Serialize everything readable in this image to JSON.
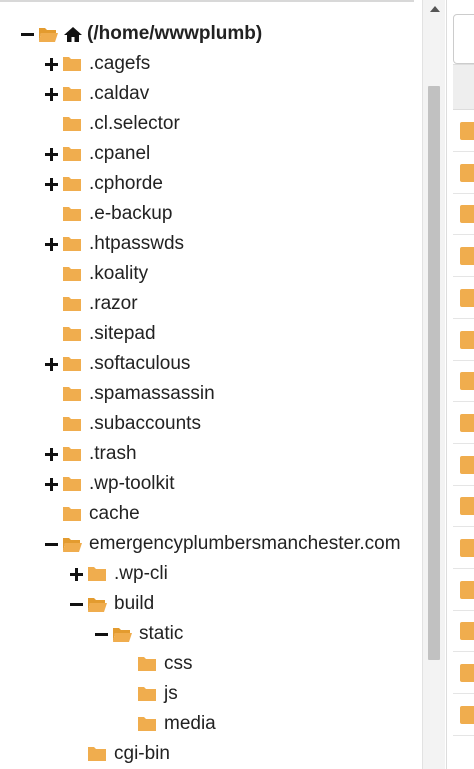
{
  "colors": {
    "folder": "#f0ad4e",
    "folder_dark": "#e39b2f",
    "text": "#222222",
    "scrollbar_thumb": "#c1c1c1"
  },
  "icons": {
    "root_toggle": "minus-icon",
    "root_folder": "folder-open-icon",
    "root_home": "home-icon"
  },
  "tree": {
    "root": {
      "label": "(/home/wwwplumb)",
      "expanded": true
    },
    "items": [
      {
        "label": ".cagefs",
        "toggle": "plus",
        "open": false,
        "level": 1
      },
      {
        "label": ".caldav",
        "toggle": "plus",
        "open": false,
        "level": 1
      },
      {
        "label": ".cl.selector",
        "toggle": "none",
        "open": false,
        "level": 1
      },
      {
        "label": ".cpanel",
        "toggle": "plus",
        "open": false,
        "level": 1
      },
      {
        "label": ".cphorde",
        "toggle": "plus",
        "open": false,
        "level": 1
      },
      {
        "label": ".e-backup",
        "toggle": "none",
        "open": false,
        "level": 1
      },
      {
        "label": ".htpasswds",
        "toggle": "plus",
        "open": false,
        "level": 1
      },
      {
        "label": ".koality",
        "toggle": "none",
        "open": false,
        "level": 1
      },
      {
        "label": ".razor",
        "toggle": "none",
        "open": false,
        "level": 1
      },
      {
        "label": ".sitepad",
        "toggle": "none",
        "open": false,
        "level": 1
      },
      {
        "label": ".softaculous",
        "toggle": "plus",
        "open": false,
        "level": 1
      },
      {
        "label": ".spamassassin",
        "toggle": "none",
        "open": false,
        "level": 1
      },
      {
        "label": ".subaccounts",
        "toggle": "none",
        "open": false,
        "level": 1
      },
      {
        "label": ".trash",
        "toggle": "plus",
        "open": false,
        "level": 1
      },
      {
        "label": ".wp-toolkit",
        "toggle": "plus",
        "open": false,
        "level": 1
      },
      {
        "label": "cache",
        "toggle": "none",
        "open": false,
        "level": 1
      },
      {
        "label": "emergencyplumbersmanchester.com",
        "toggle": "minus",
        "open": true,
        "level": 1
      },
      {
        "label": ".wp-cli",
        "toggle": "plus",
        "open": false,
        "level": 2
      },
      {
        "label": "build",
        "toggle": "minus",
        "open": true,
        "level": 2
      },
      {
        "label": "static",
        "toggle": "minus",
        "open": true,
        "level": 3
      },
      {
        "label": "css",
        "toggle": "none",
        "open": false,
        "level": 4
      },
      {
        "label": "js",
        "toggle": "none",
        "open": false,
        "level": 4
      },
      {
        "label": "media",
        "toggle": "none",
        "open": false,
        "level": 4
      },
      {
        "label": "cgi-bin",
        "toggle": "none",
        "open": false,
        "level": 2
      }
    ]
  },
  "file_list": {
    "visible_rows": 15,
    "row_icon": "file-icon"
  }
}
